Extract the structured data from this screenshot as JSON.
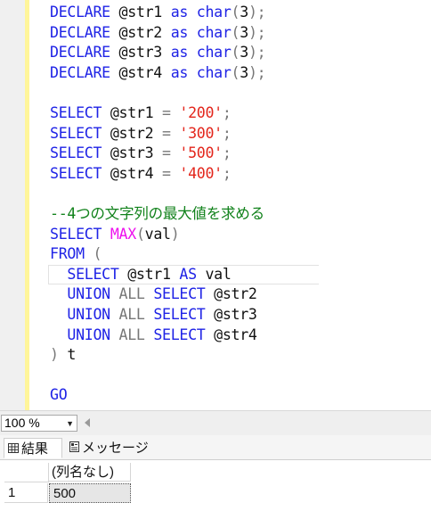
{
  "editor": {
    "lines": [
      [
        {
          "t": "DECLARE",
          "c": "kw"
        },
        {
          "t": " @str1 ",
          "c": "tx"
        },
        {
          "t": "as",
          "c": "kw"
        },
        {
          "t": " ",
          "c": "tx"
        },
        {
          "t": "char",
          "c": "kw"
        },
        {
          "t": "(",
          "c": "op"
        },
        {
          "t": "3",
          "c": "tx"
        },
        {
          "t": ");",
          "c": "op"
        }
      ],
      [
        {
          "t": "DECLARE",
          "c": "kw"
        },
        {
          "t": " @str2 ",
          "c": "tx"
        },
        {
          "t": "as",
          "c": "kw"
        },
        {
          "t": " ",
          "c": "tx"
        },
        {
          "t": "char",
          "c": "kw"
        },
        {
          "t": "(",
          "c": "op"
        },
        {
          "t": "3",
          "c": "tx"
        },
        {
          "t": ");",
          "c": "op"
        }
      ],
      [
        {
          "t": "DECLARE",
          "c": "kw"
        },
        {
          "t": " @str3 ",
          "c": "tx"
        },
        {
          "t": "as",
          "c": "kw"
        },
        {
          "t": " ",
          "c": "tx"
        },
        {
          "t": "char",
          "c": "kw"
        },
        {
          "t": "(",
          "c": "op"
        },
        {
          "t": "3",
          "c": "tx"
        },
        {
          "t": ");",
          "c": "op"
        }
      ],
      [
        {
          "t": "DECLARE",
          "c": "kw"
        },
        {
          "t": " @str4 ",
          "c": "tx"
        },
        {
          "t": "as",
          "c": "kw"
        },
        {
          "t": " ",
          "c": "tx"
        },
        {
          "t": "char",
          "c": "kw"
        },
        {
          "t": "(",
          "c": "op"
        },
        {
          "t": "3",
          "c": "tx"
        },
        {
          "t": ");",
          "c": "op"
        }
      ],
      [],
      [
        {
          "t": "SELECT",
          "c": "kw"
        },
        {
          "t": " @str1 ",
          "c": "tx"
        },
        {
          "t": "=",
          "c": "op"
        },
        {
          "t": " ",
          "c": "tx"
        },
        {
          "t": "'200'",
          "c": "str"
        },
        {
          "t": ";",
          "c": "op"
        }
      ],
      [
        {
          "t": "SELECT",
          "c": "kw"
        },
        {
          "t": " @str2 ",
          "c": "tx"
        },
        {
          "t": "=",
          "c": "op"
        },
        {
          "t": " ",
          "c": "tx"
        },
        {
          "t": "'300'",
          "c": "str"
        },
        {
          "t": ";",
          "c": "op"
        }
      ],
      [
        {
          "t": "SELECT",
          "c": "kw"
        },
        {
          "t": " @str3 ",
          "c": "tx"
        },
        {
          "t": "=",
          "c": "op"
        },
        {
          "t": " ",
          "c": "tx"
        },
        {
          "t": "'500'",
          "c": "str"
        },
        {
          "t": ";",
          "c": "op"
        }
      ],
      [
        {
          "t": "SELECT",
          "c": "kw"
        },
        {
          "t": " @str4 ",
          "c": "tx"
        },
        {
          "t": "=",
          "c": "op"
        },
        {
          "t": " ",
          "c": "tx"
        },
        {
          "t": "'400'",
          "c": "str"
        },
        {
          "t": ";",
          "c": "op"
        }
      ],
      [],
      [
        {
          "t": "--4つの文字列の最大値を求める",
          "c": "cm"
        }
      ],
      [
        {
          "t": "SELECT",
          "c": "kw"
        },
        {
          "t": " ",
          "c": "tx"
        },
        {
          "t": "MAX",
          "c": "fn"
        },
        {
          "t": "(",
          "c": "op"
        },
        {
          "t": "val",
          "c": "tx"
        },
        {
          "t": ")",
          "c": "op"
        }
      ],
      [
        {
          "t": "FROM",
          "c": "kw"
        },
        {
          "t": " ",
          "c": "tx"
        },
        {
          "t": "(",
          "c": "op"
        }
      ],
      [
        {
          "t": "  ",
          "c": "tx"
        },
        {
          "t": "SELECT",
          "c": "kw"
        },
        {
          "t": " @str1 ",
          "c": "tx"
        },
        {
          "t": "AS",
          "c": "kw"
        },
        {
          "t": " val",
          "c": "tx"
        }
      ],
      [
        {
          "t": "  ",
          "c": "tx"
        },
        {
          "t": "UNION",
          "c": "kw"
        },
        {
          "t": " ",
          "c": "tx"
        },
        {
          "t": "ALL",
          "c": "op"
        },
        {
          "t": " ",
          "c": "tx"
        },
        {
          "t": "SELECT",
          "c": "kw"
        },
        {
          "t": " @str2",
          "c": "tx"
        }
      ],
      [
        {
          "t": "  ",
          "c": "tx"
        },
        {
          "t": "UNION",
          "c": "kw"
        },
        {
          "t": " ",
          "c": "tx"
        },
        {
          "t": "ALL",
          "c": "op"
        },
        {
          "t": " ",
          "c": "tx"
        },
        {
          "t": "SELECT",
          "c": "kw"
        },
        {
          "t": " @str3",
          "c": "tx"
        }
      ],
      [
        {
          "t": "  ",
          "c": "tx"
        },
        {
          "t": "UNION",
          "c": "kw"
        },
        {
          "t": " ",
          "c": "tx"
        },
        {
          "t": "ALL",
          "c": "op"
        },
        {
          "t": " ",
          "c": "tx"
        },
        {
          "t": "SELECT",
          "c": "kw"
        },
        {
          "t": " @str4",
          "c": "tx"
        }
      ],
      [
        {
          "t": ")",
          "c": "op"
        },
        {
          "t": " t",
          "c": "tx"
        }
      ],
      [],
      [
        {
          "t": "GO",
          "c": "kw"
        }
      ]
    ],
    "current_line": 13
  },
  "statusbar": {
    "zoom": "100 %"
  },
  "tabs": {
    "results": "結果",
    "messages": "メッセージ"
  },
  "results": {
    "column_header": "(列名なし)",
    "rows": [
      {
        "num": "1",
        "value": "500"
      }
    ]
  },
  "colors": {
    "keyword": "#1f23e6",
    "function": "#ee11ee",
    "string": "#e3261c",
    "comment": "#11821b",
    "operator": "#777777",
    "change_bar": "#fff59a"
  }
}
